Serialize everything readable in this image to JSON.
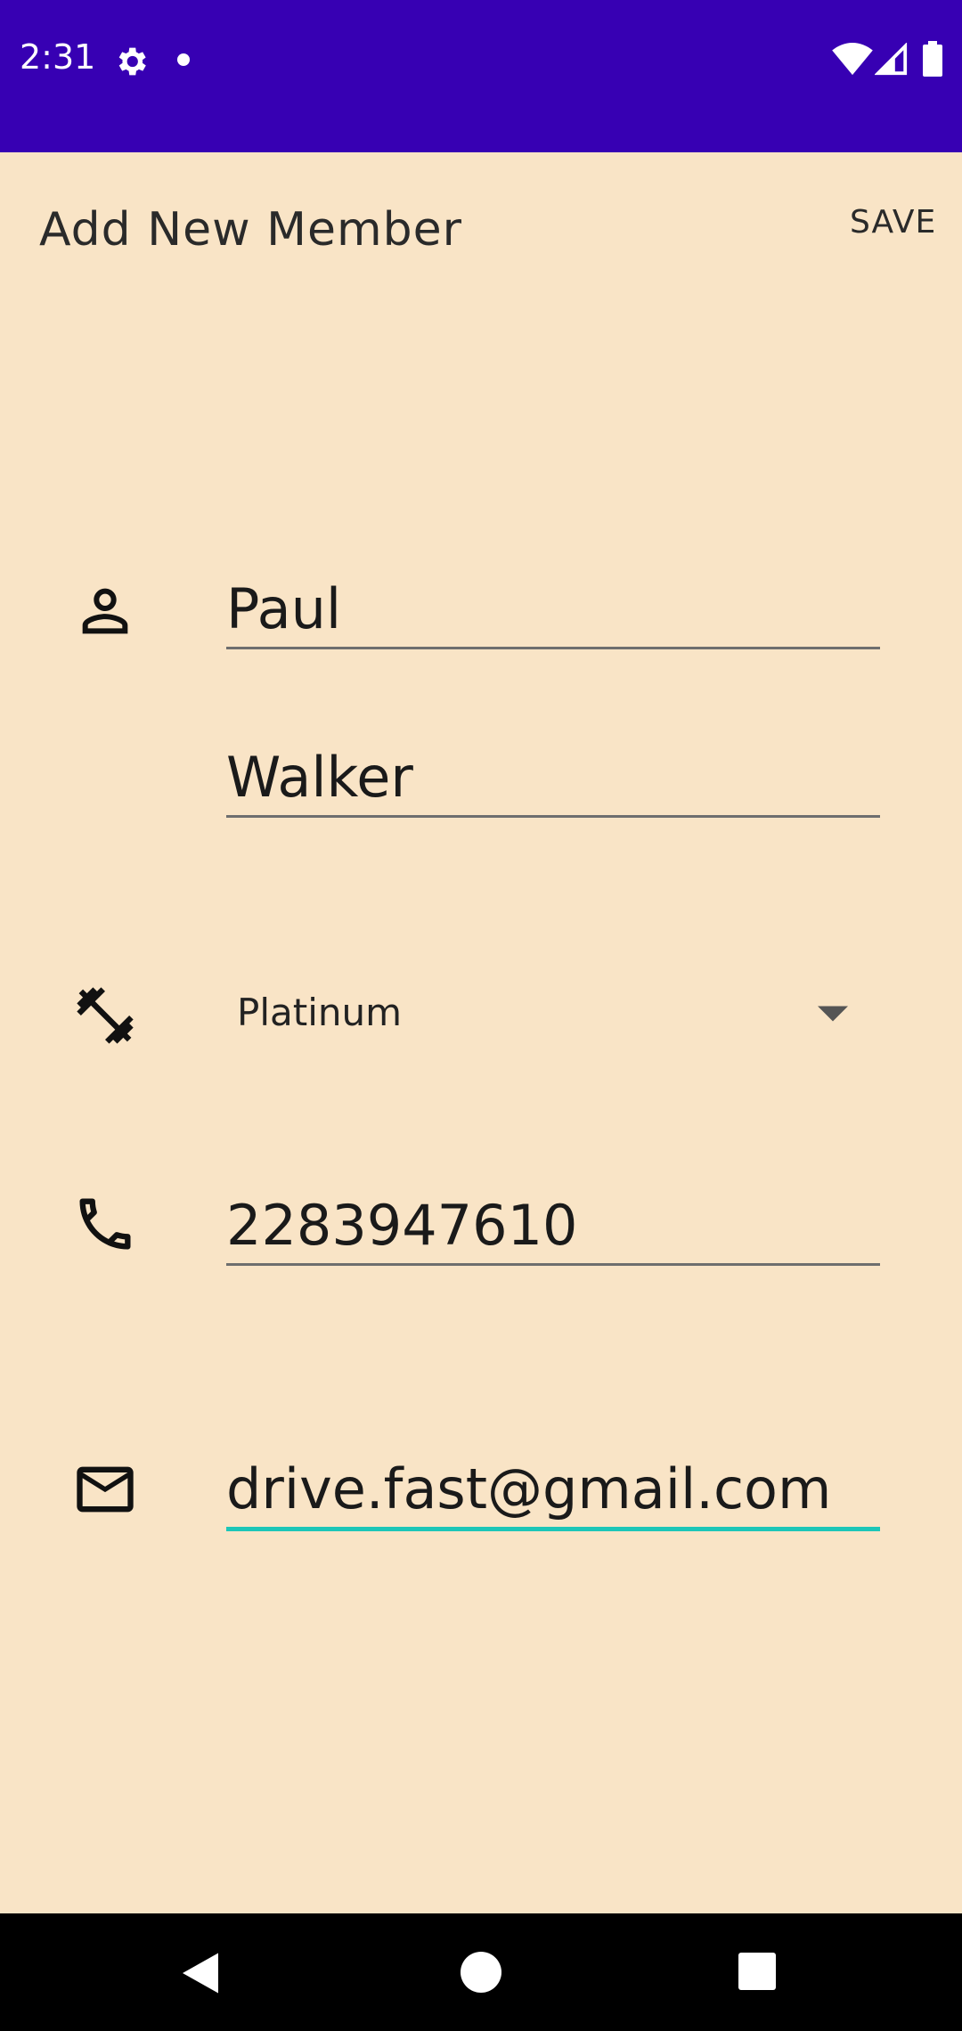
{
  "status_bar": {
    "time": "2:31",
    "icons": [
      "gear-icon",
      "dot-icon",
      "wifi-icon",
      "signal-icon",
      "battery-icon"
    ],
    "background": "#3700B3"
  },
  "app_bar": {
    "title": "Add New Member",
    "save_label": "SAVE"
  },
  "form": {
    "first_name": "Paul",
    "last_name": "Walker",
    "membership": "Platinum",
    "phone": "2283947610",
    "email": "drive.fast@gmail.com",
    "focus_color": "#1DC6B8"
  },
  "icons": {
    "name": "person-icon",
    "membership": "dumbbell-icon",
    "phone": "phone-icon",
    "email": "email-icon"
  },
  "nav_bar": {
    "buttons": [
      "back-icon",
      "home-icon",
      "recents-icon"
    ]
  }
}
